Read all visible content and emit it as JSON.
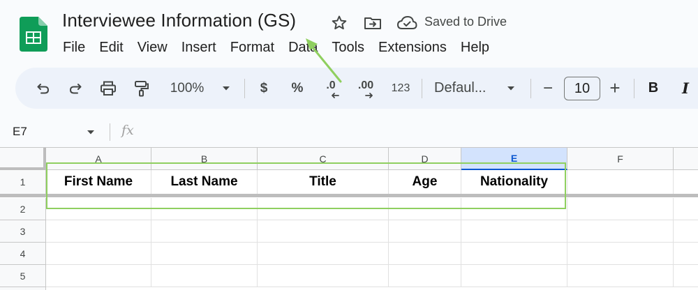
{
  "doc": {
    "title": "Interviewee Information (GS)",
    "saved_status": "Saved to Drive"
  },
  "icons": {
    "app_logo": "google-sheets-logo",
    "star": "star-icon",
    "move": "move-to-folder-icon",
    "cloud": "cloud-saved-icon"
  },
  "menu": [
    "File",
    "Edit",
    "View",
    "Insert",
    "Format",
    "Data",
    "Tools",
    "Extensions",
    "Help"
  ],
  "toolbar": {
    "zoom": "100%",
    "currency": "$",
    "percent": "%",
    "decrease_decimal": ".0",
    "increase_decimal": ".00",
    "number_format": "123",
    "font": "Defaul...",
    "minus": "−",
    "font_size": "10",
    "plus": "+",
    "bold": "B",
    "italic": "I"
  },
  "formula_bar": {
    "name_box": "E7",
    "fx": "fx"
  },
  "sheet": {
    "columns": [
      "A",
      "B",
      "C",
      "D",
      "E",
      "F"
    ],
    "selected_column": "E",
    "rows": [
      "1",
      "2",
      "3",
      "4",
      "5"
    ],
    "header_row": [
      "First Name",
      "Last Name",
      "Title",
      "Age",
      "Nationality"
    ]
  },
  "colors": {
    "accent": "#0b57d0",
    "annotation": "#8fcf5f",
    "sheets_green": "#0f9d58"
  }
}
